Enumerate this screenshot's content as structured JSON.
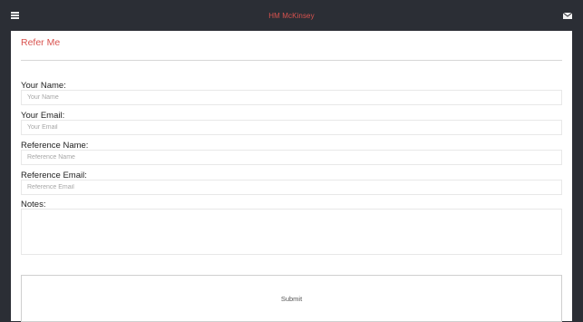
{
  "header": {
    "title": "HM McKinsey",
    "menu_icon": "hamburger-menu-icon",
    "mail_icon": "envelope-icon"
  },
  "form": {
    "title": "Refer Me",
    "your_name": {
      "label": "Your Name:",
      "placeholder": "Your Name"
    },
    "your_email": {
      "label": "Your Email:",
      "placeholder": "Your Email"
    },
    "reference_name": {
      "label": "Reference Name:",
      "placeholder": "Reference Name"
    },
    "reference_email": {
      "label": "Reference Email:",
      "placeholder": "Reference Email"
    },
    "notes": {
      "label": "Notes:"
    },
    "submit_label": "Submit"
  },
  "colors": {
    "background": "#2b2e35",
    "accent": "#d9534f",
    "card": "#ffffff"
  }
}
